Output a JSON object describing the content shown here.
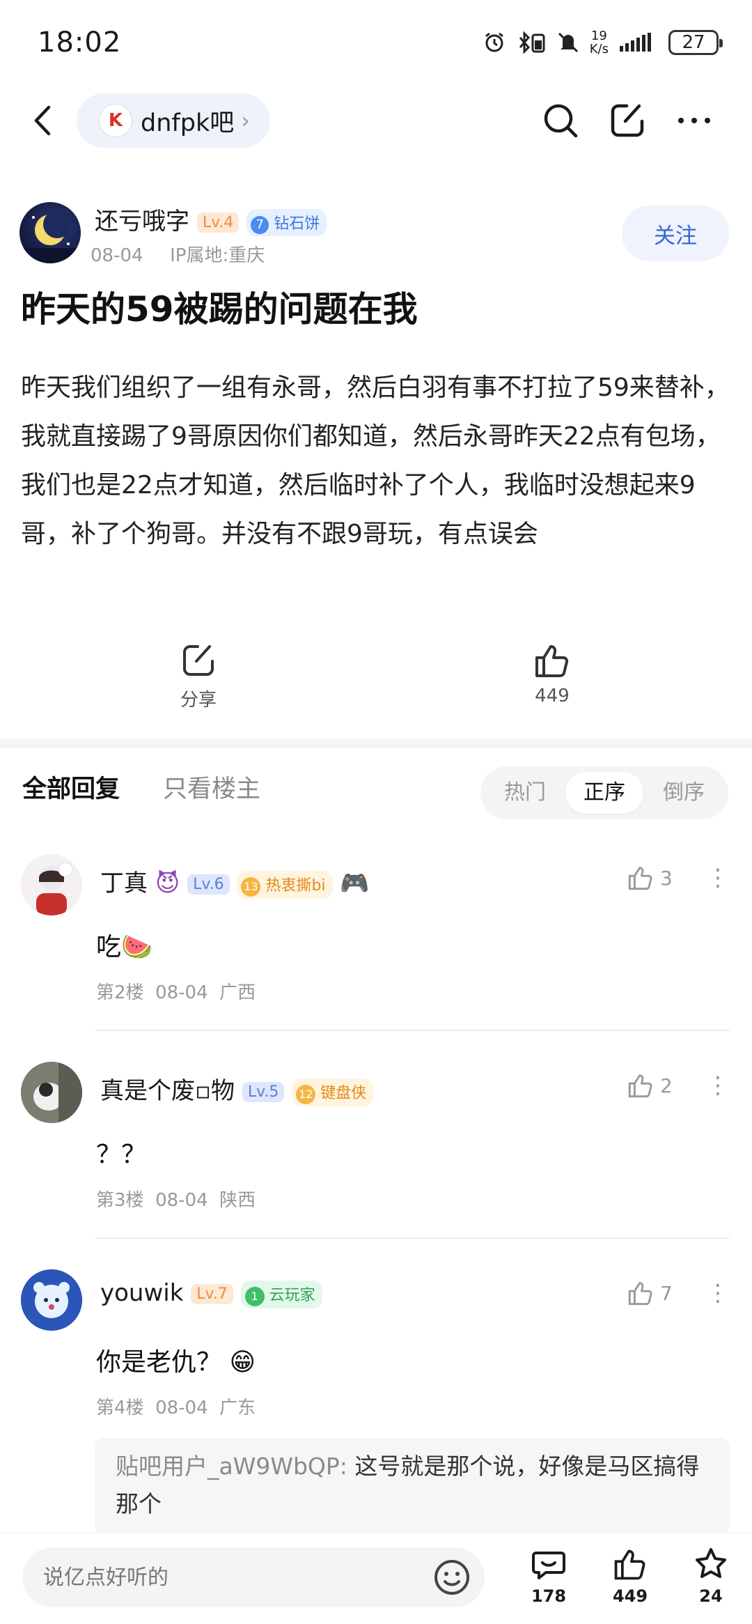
{
  "status_bar": {
    "time": "18:02",
    "net_speed_value": "19",
    "net_speed_unit": "K/s",
    "battery": "27"
  },
  "nav": {
    "forum_logo_text": "K",
    "forum_name": "dnfpk吧",
    "chevron": "›"
  },
  "post": {
    "author": "还亏哦字",
    "author_level": "Lv.4",
    "author_tag_rank": "7",
    "author_tag": "钻石饼",
    "date": "08-04",
    "ip": "IP属地:重庆",
    "follow_label": "关注",
    "title": "昨天的59被踢的问题在我",
    "body": "昨天我们组织了一组有永哥，然后白羽有事不打拉了59来替补，我就直接踢了9哥原因你们都知道，然后永哥昨天22点有包场，我们也是22点才知道，然后临时补了个人，我临时没想起来9哥，补了个狗哥。并没有不跟9哥玩，有点误会",
    "share_label": "分享",
    "like_count": "449"
  },
  "replies_header": {
    "tab_all": "全部回复",
    "tab_op": "只看楼主",
    "sort_hot": "热门",
    "sort_asc": "正序",
    "sort_desc": "倒序"
  },
  "comments": [
    {
      "name": "丁真",
      "level": "Lv.6",
      "tag_rank": "13",
      "tag": "热衷撕bi",
      "body": "吃🍉",
      "floor": "第2楼",
      "date": "08-04",
      "region": "广西",
      "likes": "3"
    },
    {
      "name": "真是个废▫物",
      "level": "Lv.5",
      "tag_rank": "12",
      "tag": "键盘侠",
      "body": "？？",
      "floor": "第3楼",
      "date": "08-04",
      "region": "陕西",
      "likes": "2"
    },
    {
      "name": "youwik",
      "level": "Lv.7",
      "tag_rank": "1",
      "tag": "云玩家",
      "body": "你是老仇？ 😁",
      "floor": "第4楼",
      "date": "08-04",
      "region": "广东",
      "likes": "7",
      "sub_reply_author": "贴吧用户_aW9WbQP:",
      "sub_reply_text": " 这号就是那个说，好像是马区搞得那个"
    }
  ],
  "bottom_bar": {
    "input_placeholder": "说亿点好听的",
    "comment_count": "178",
    "like_count": "449",
    "fav_count": "24"
  },
  "colors": {
    "accent_blue": "#3766d6",
    "level_orange": "#f59a3c",
    "level_blue": "#5a7fd8"
  }
}
